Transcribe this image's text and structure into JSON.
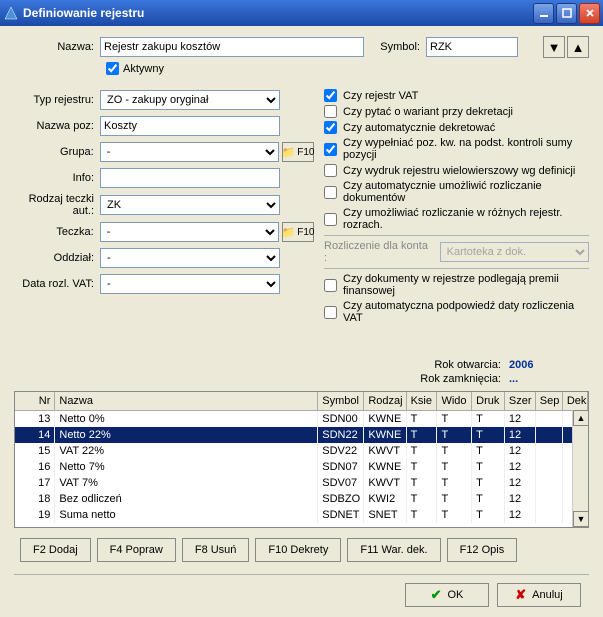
{
  "window": {
    "title": "Definiowanie rejestru"
  },
  "labels": {
    "nazwa": "Nazwa:",
    "symbol": "Symbol:",
    "aktywny": "Aktywny",
    "typ_rejestru": "Typ rejestru:",
    "nazwa_poz": "Nazwa poz:",
    "grupa": "Grupa:",
    "info": "Info:",
    "rodzaj_teczki": "Rodzaj teczki aut.:",
    "teczka": "Teczka:",
    "oddzial": "Oddział:",
    "data_rozl": "Data rozl. VAT:",
    "rozlicz_konta": "Rozliczenie dla konta :",
    "rok_otwarcia": "Rok otwarcia:",
    "rok_zamkniecia": "Rok zamknięcia:",
    "f10": "F10"
  },
  "fields": {
    "nazwa": "Rejestr zakupu kosztów",
    "symbol": "RZK",
    "aktywny": true,
    "typ_rejestru": "ZO - zakupy oryginał",
    "nazwa_poz": "Koszty",
    "grupa": "-",
    "info": "",
    "rodzaj_teczki": "ZK",
    "teczka": "-",
    "oddzial": "-",
    "data_rozl": "-",
    "rozlicz_konta": "Kartoteka z dok."
  },
  "checks": {
    "c1": {
      "label": "Czy rejestr VAT",
      "checked": true
    },
    "c2": {
      "label": "Czy pytać o wariant przy dekretacji",
      "checked": false
    },
    "c3": {
      "label": "Czy automatycznie dekretować",
      "checked": true
    },
    "c4": {
      "label": "Czy wypełniać poz. kw. na podst. kontroli sumy pozycji",
      "checked": true
    },
    "c5": {
      "label": "Czy wydruk rejestru wielowierszowy wg definicji",
      "checked": false
    },
    "c6": {
      "label": "Czy automatycznie umożliwić rozliczanie dokumentów",
      "checked": false
    },
    "c7": {
      "label": "Czy umożliwiać rozliczanie w różnych rejestr. rozrach.",
      "checked": false
    },
    "c8": {
      "label": "Czy dokumenty w rejestrze podlegają premii finansowej",
      "checked": false
    },
    "c9": {
      "label": "Czy automatyczna podpowiedź daty rozliczenia VAT",
      "checked": false
    }
  },
  "year": {
    "otwarcia": "2006",
    "zamkniecia": "..."
  },
  "table": {
    "headers": {
      "nr": "Nr",
      "nazwa": "Nazwa",
      "symbol": "Symbol",
      "rodzaj": "Rodzaj",
      "ksie": "Ksie",
      "wido": "Wido",
      "druk": "Druk",
      "szer": "Szer",
      "sep": "Sep",
      "dek": "Dek"
    },
    "rows": [
      {
        "nr": "13",
        "nazwa": "Netto 0%",
        "symbol": "SDN00",
        "rodzaj": "KWNE",
        "ksie": "T",
        "wido": "T",
        "druk": "T",
        "szer": "12",
        "sep": "",
        "dek": "",
        "selected": false
      },
      {
        "nr": "14",
        "nazwa": "Netto 22%",
        "symbol": "SDN22",
        "rodzaj": "KWNE",
        "ksie": "T",
        "wido": "T",
        "druk": "T",
        "szer": "12",
        "sep": "",
        "dek": "",
        "selected": true
      },
      {
        "nr": "15",
        "nazwa": "VAT 22%",
        "symbol": "SDV22",
        "rodzaj": "KWVT",
        "ksie": "T",
        "wido": "T",
        "druk": "T",
        "szer": "12",
        "sep": "",
        "dek": "",
        "selected": false
      },
      {
        "nr": "16",
        "nazwa": "Netto 7%",
        "symbol": "SDN07",
        "rodzaj": "KWNE",
        "ksie": "T",
        "wido": "T",
        "druk": "T",
        "szer": "12",
        "sep": "",
        "dek": "",
        "selected": false
      },
      {
        "nr": "17",
        "nazwa": "VAT 7%",
        "symbol": "SDV07",
        "rodzaj": "KWVT",
        "ksie": "T",
        "wido": "T",
        "druk": "T",
        "szer": "12",
        "sep": "",
        "dek": "",
        "selected": false
      },
      {
        "nr": "18",
        "nazwa": "Bez odliczeń",
        "symbol": "SDBZO",
        "rodzaj": "KWI2",
        "ksie": "T",
        "wido": "T",
        "druk": "T",
        "szer": "12",
        "sep": "",
        "dek": "",
        "selected": false
      },
      {
        "nr": "19",
        "nazwa": "Suma netto",
        "symbol": "SDNET",
        "rodzaj": "SNET",
        "ksie": "T",
        "wido": "T",
        "druk": "T",
        "szer": "12",
        "sep": "",
        "dek": "",
        "selected": false
      }
    ]
  },
  "buttons": {
    "f2": "F2 Dodaj",
    "f4": "F4 Popraw",
    "f8": "F8 Usuń",
    "f10": "F10 Dekrety",
    "f11": "F11 War. dek.",
    "f12": "F12 Opis",
    "ok": "OK",
    "anuluj": "Anuluj"
  }
}
